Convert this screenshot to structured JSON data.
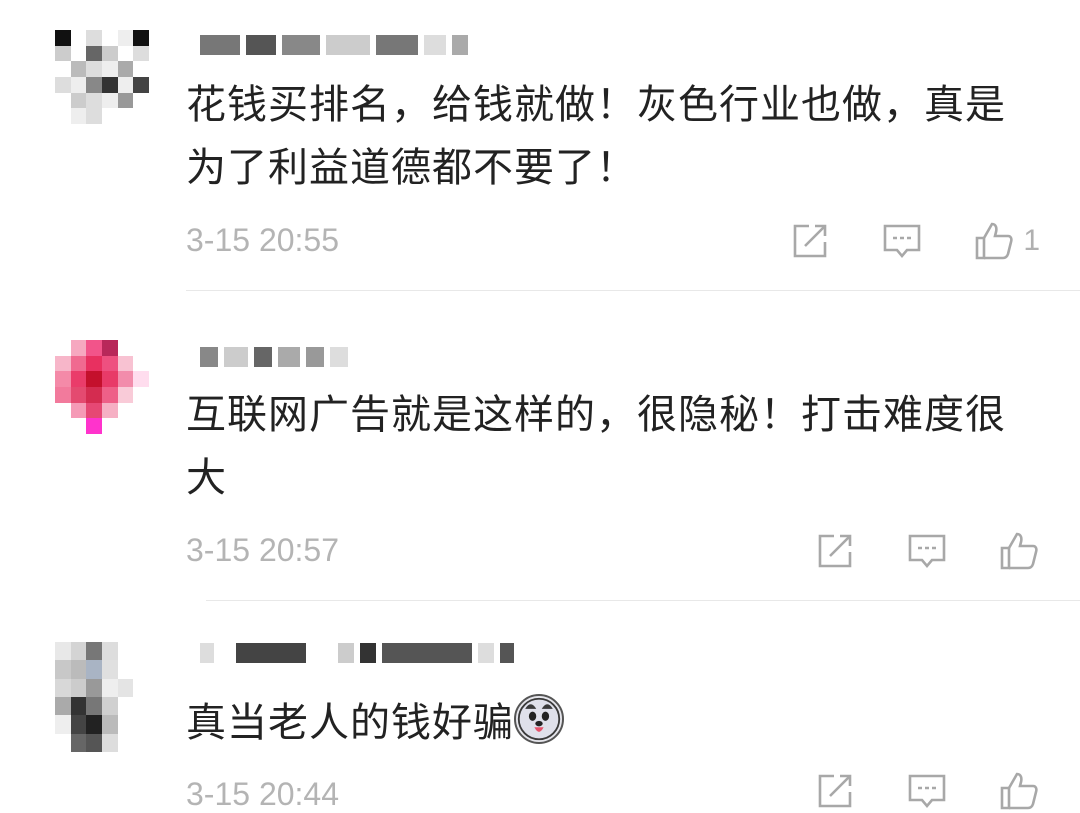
{
  "comments": [
    {
      "text": "花钱买排名，给钱就做！灰色行业也做，真是为了利益道德都不要了！",
      "time": "3-15 20:55",
      "like_count": "1",
      "icons": {
        "share": "share-icon",
        "reply": "comment-icon",
        "like": "thumbs-up-icon"
      }
    },
    {
      "text": "互联网广告就是这样的，很隐秘！打击难度很大",
      "time": "3-15 20:57",
      "like_count": "",
      "icons": {
        "share": "share-icon",
        "reply": "comment-icon",
        "like": "thumbs-up-icon"
      }
    },
    {
      "text": "真当老人的钱好骗",
      "emoji": "husky-dog-emoji",
      "time": "3-15 20:44",
      "like_count": "",
      "icons": {
        "share": "share-icon",
        "reply": "comment-icon",
        "like": "thumbs-up-icon"
      }
    }
  ],
  "colors": {
    "text": "#222222",
    "meta": "#b4b4b4",
    "icon": "#a8a8a8",
    "divider": "#e8e8e8"
  }
}
